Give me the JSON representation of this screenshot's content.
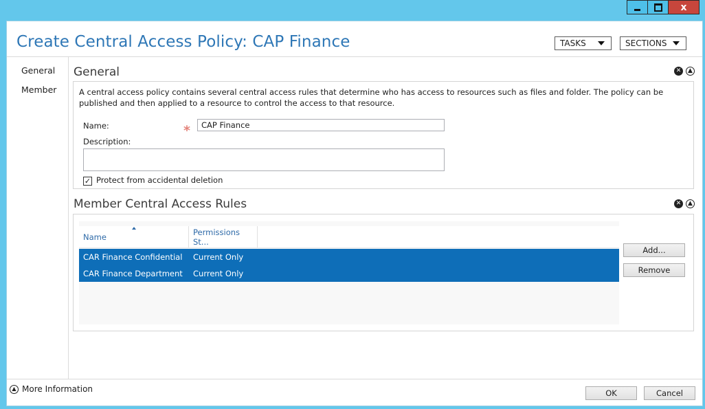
{
  "window": {
    "title": "Create Central Access Policy: CAP Finance",
    "controls": {
      "minimize": "minimize-icon",
      "maximize": "maximize-icon",
      "close": "close-icon",
      "close_glyph": "x"
    }
  },
  "header": {
    "tasks_label": "TASKS",
    "sections_label": "SECTIONS"
  },
  "sidebar": {
    "items": [
      {
        "label": "General"
      },
      {
        "label": "Member"
      }
    ]
  },
  "general": {
    "title": "General",
    "description": "A central access policy contains several central access rules that determine who has access to resources such as files and folder. The policy can be published and then applied to a resource to control the access to that resource.",
    "name_label": "Name:",
    "required_marker": "*",
    "name_value": "CAP Finance",
    "description_label": "Description:",
    "description_value": "",
    "protect_label": "Protect from accidental deletion",
    "protect_checked": true
  },
  "members": {
    "title": "Member Central Access Rules",
    "columns": [
      "Name",
      "Permissions St..."
    ],
    "rows": [
      {
        "name": "CAR Finance Confidential",
        "permissions": "Current Only"
      },
      {
        "name": "CAR Finance Department",
        "permissions": "Current Only"
      }
    ],
    "add_label": "Add...",
    "remove_label": "Remove"
  },
  "section_icons": {
    "close": "close-circle-icon",
    "collapse": "collapse-circle-icon"
  },
  "footer": {
    "more_info_label": "More Information",
    "ok_label": "OK",
    "cancel_label": "Cancel"
  },
  "colors": {
    "title": "#2e77b6",
    "selection": "#0e6eb8",
    "frame": "#63c7eb",
    "close": "#c7463c",
    "required": "#e4837a"
  }
}
